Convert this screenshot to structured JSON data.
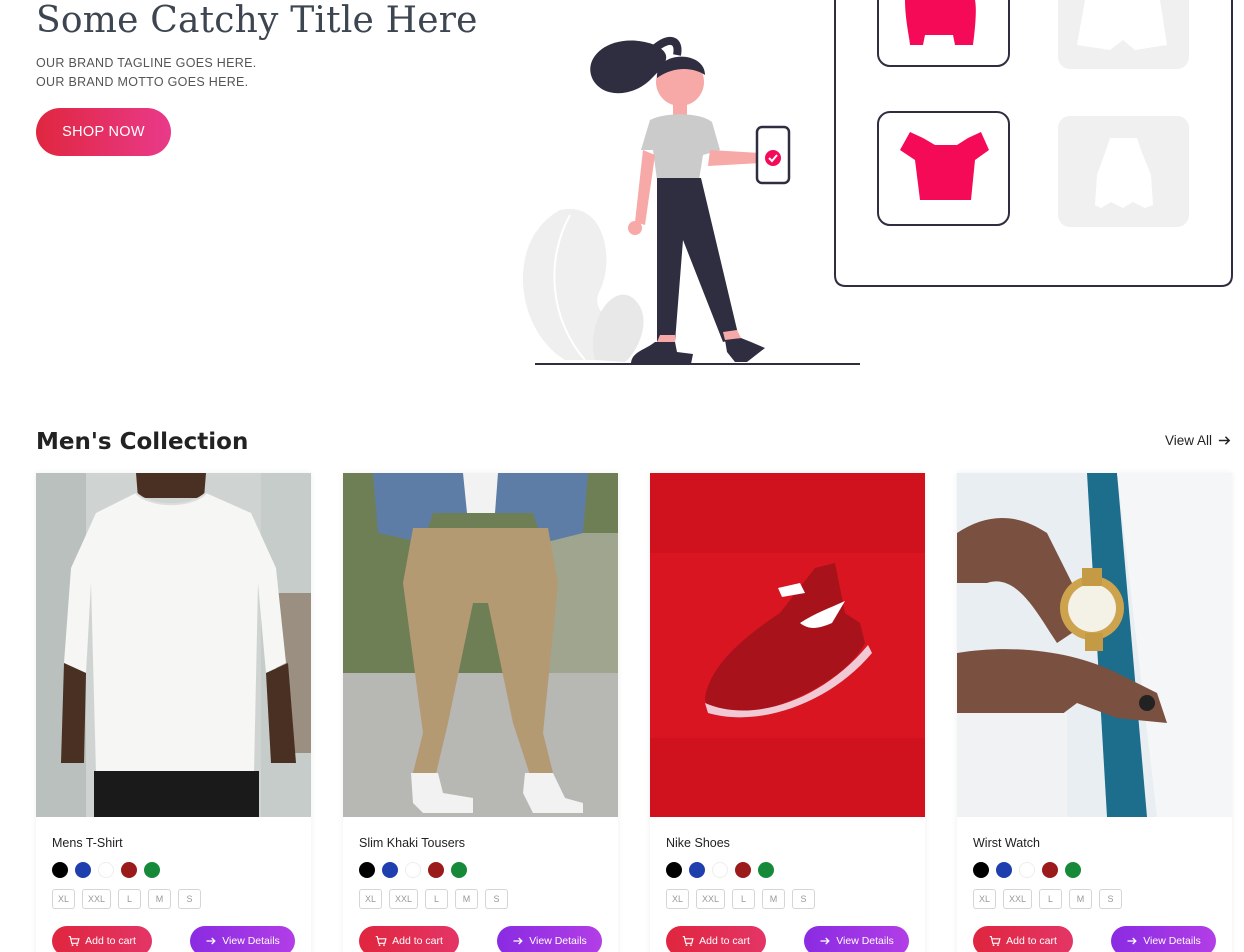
{
  "hero": {
    "title": "Some Catchy Title Here",
    "tagline": "OUR BRAND TAGLINE GOES HERE.",
    "motto": "OUR BRAND MOTTO GOES HERE.",
    "cta_label": "SHOP NOW"
  },
  "collection": {
    "title": "Men's Collection",
    "view_all_label": "View All",
    "products": [
      {
        "name": "Mens T-Shirt",
        "add_to_cart": "Add to cart",
        "view_details": "View Details"
      },
      {
        "name": "Slim Khaki Tousers",
        "add_to_cart": "Add to cart",
        "view_details": "View Details"
      },
      {
        "name": "Nike Shoes",
        "add_to_cart": "Add to cart",
        "view_details": "View Details"
      },
      {
        "name": "Wirst Watch",
        "add_to_cart": "Add to cart",
        "view_details": "View Details"
      }
    ],
    "colors": [
      "#000000",
      "#1f3fae",
      "#ffffff",
      "#9b1b1b",
      "#178a3a"
    ],
    "sizes": [
      "XL",
      "XXL",
      "L",
      "M",
      "S"
    ]
  },
  "theme": {
    "accent_red": "#e0263f",
    "accent_purple": "#8a2be2",
    "illustration_pink": "#f50a57",
    "illustration_dark": "#2f2e41"
  }
}
